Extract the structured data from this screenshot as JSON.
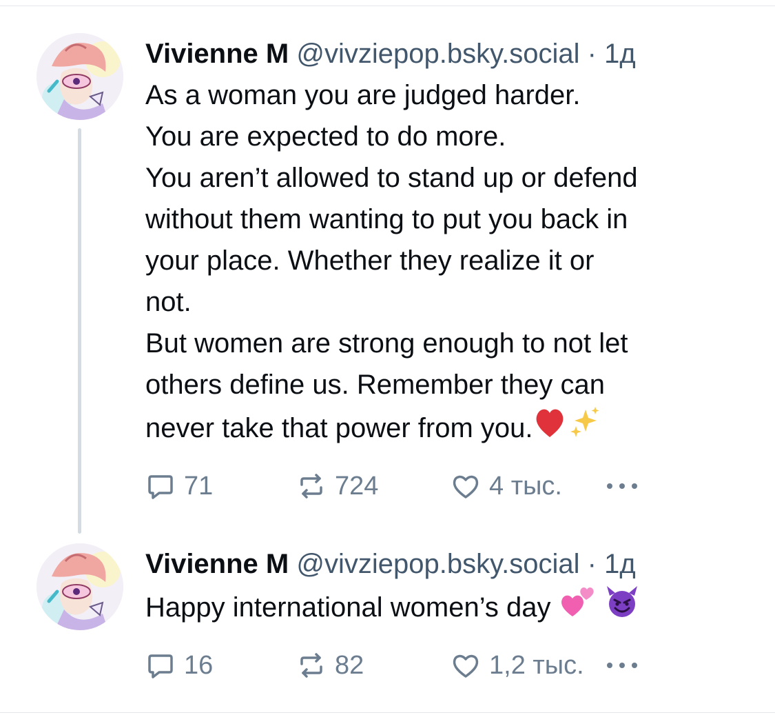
{
  "posts": [
    {
      "author_name": "Vivienne M",
      "handle": "@vivziepop.bsky.social",
      "separator": "·",
      "time": "1д",
      "text": "As a woman you are judged harder.\nYou are expected to do more.\nYou aren’t allowed to stand up or defend\nwithout them wanting to put you back in\nyour place. Whether they realize it or\nnot.\nBut women are strong enough to not let\nothers define us. Remember they can\nnever take that power from you.",
      "trailing_emoji": "❤️✨",
      "stats": {
        "replies": "71",
        "reposts": "724",
        "likes": "4 тыс."
      }
    },
    {
      "author_name": "Vivienne M",
      "handle": "@vivziepop.bsky.social",
      "separator": "·",
      "time": "1д",
      "text": "Happy international women’s day",
      "trailing_emoji": "💕😈",
      "stats": {
        "replies": "16",
        "reposts": "82",
        "likes": "1,2 тыс."
      }
    }
  ],
  "icons": {
    "reply": "speech-bubble-icon",
    "repost": "repost-arrows-icon",
    "like": "heart-outline-icon",
    "more": "ellipsis-icon"
  },
  "colors": {
    "text": "#0b0f14",
    "muted": "#42576c",
    "icon": "#6b7d8f",
    "thread_line": "#d4dbe2",
    "heart_emoji": "#e0323a",
    "sparkle": "#f7c948",
    "hearts_pink": "#f05fb0",
    "devil_purple": "#7c3fc3"
  }
}
